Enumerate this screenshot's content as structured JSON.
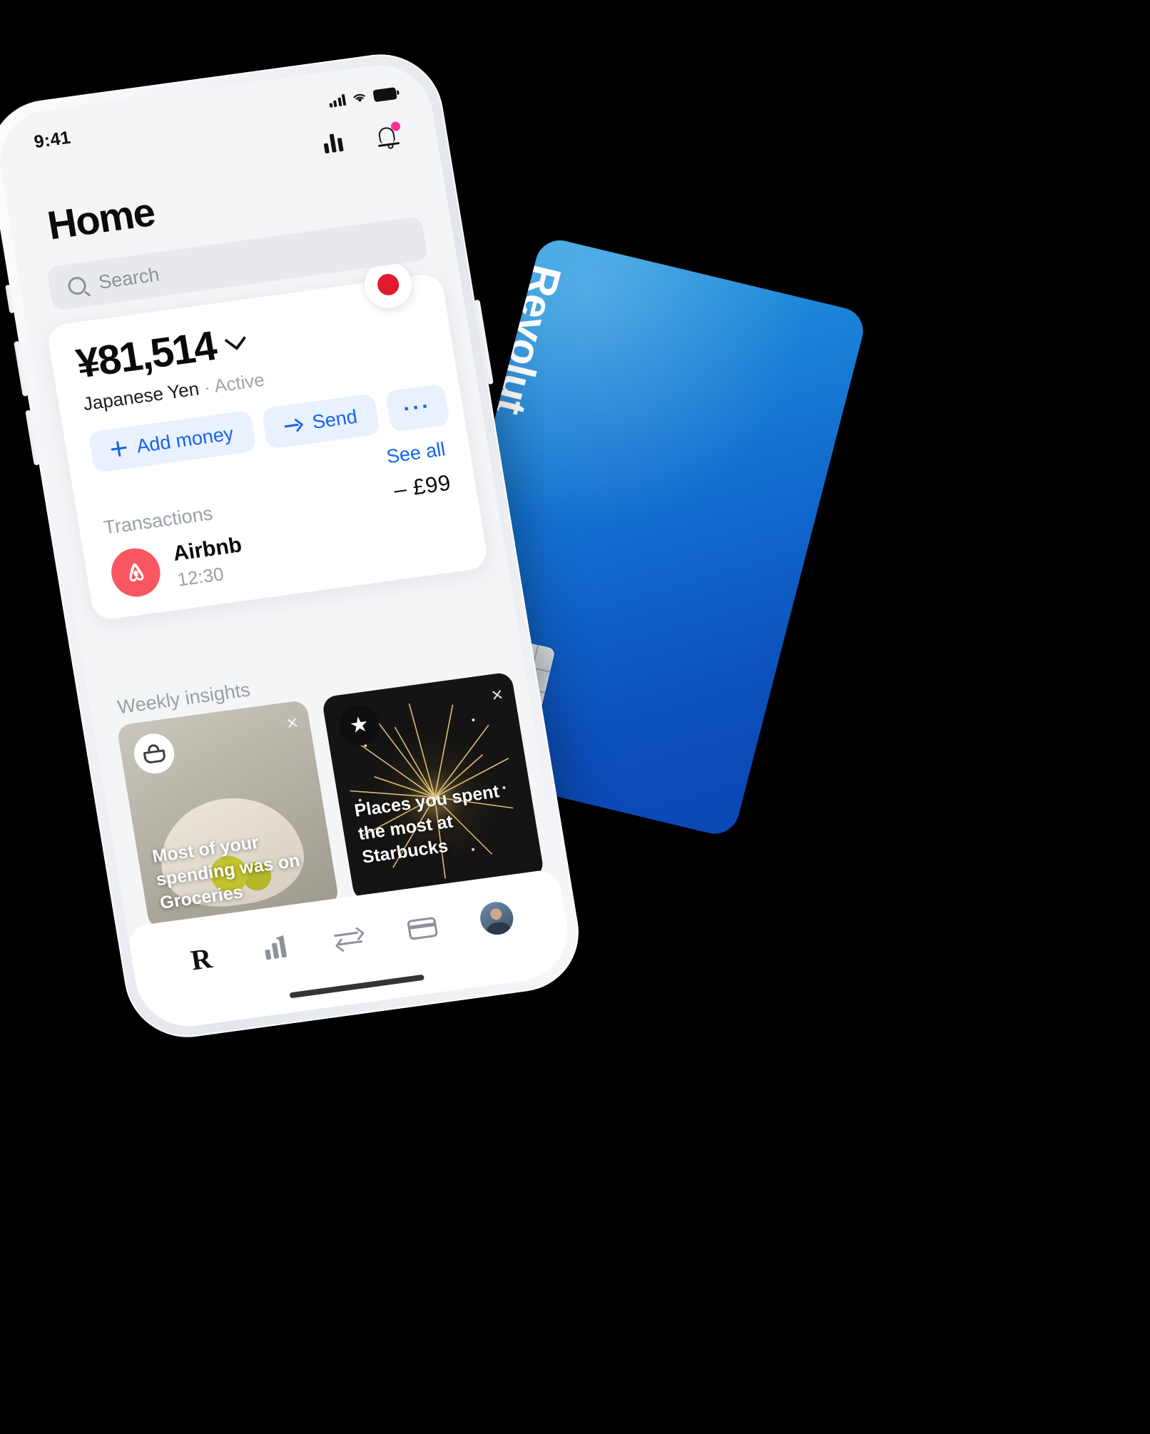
{
  "statusbar": {
    "time": "9:41",
    "signal_icon": "cellular-bars-icon",
    "wifi_icon": "wifi-icon",
    "battery_icon": "battery-icon"
  },
  "header": {
    "title": "Home",
    "analytics_icon": "bar-chart-icon",
    "notifications_icon": "bell-icon",
    "notification_badge": true
  },
  "search": {
    "placeholder": "Search",
    "icon": "search-icon"
  },
  "account": {
    "flag_icon": "japan-flag-icon",
    "balance": "¥81,514",
    "chevron_icon": "chevron-down-icon",
    "currency_name": "Japanese Yen",
    "separator": "·",
    "status": "Active",
    "actions": [
      {
        "label": "Add money",
        "icon": "plus-icon"
      },
      {
        "label": "Send",
        "icon": "arrow-right-icon"
      },
      {
        "label": "···",
        "icon": "more-icon"
      }
    ]
  },
  "transactions": {
    "see_all_label": "See all",
    "section_label": "Transactions",
    "items": [
      {
        "merchant": "Airbnb",
        "time": "12:30",
        "amount": "– £99",
        "icon": "airbnb-icon"
      }
    ]
  },
  "insights": {
    "section_label": "Weekly insights",
    "cards": [
      {
        "icon": "basket-icon",
        "close_icon": "close-icon",
        "text": "Most of your spending was on Groceries"
      },
      {
        "icon": "star-icon",
        "close_icon": "close-icon",
        "text": "Places you spent the most at Starbucks"
      }
    ]
  },
  "tabbar": {
    "items": [
      {
        "name": "home",
        "icon": "revolut-logo-icon",
        "label": "R"
      },
      {
        "name": "analytics",
        "icon": "chart-arrow-icon"
      },
      {
        "name": "exchange",
        "icon": "swap-arrows-icon"
      },
      {
        "name": "cards",
        "icon": "card-icon"
      },
      {
        "name": "profile",
        "icon": "avatar-icon"
      }
    ]
  },
  "physical_card": {
    "brand": "Revolut",
    "chip_icon": "emv-chip-icon"
  },
  "colors": {
    "accent_blue": "#1464ef",
    "card_gradient_start": "#2a9fe0",
    "card_gradient_end": "#0a47b4",
    "airbnb_red": "#fa5661",
    "flag_red": "#e01b2e",
    "badge_pink": "#ff2d9a"
  }
}
